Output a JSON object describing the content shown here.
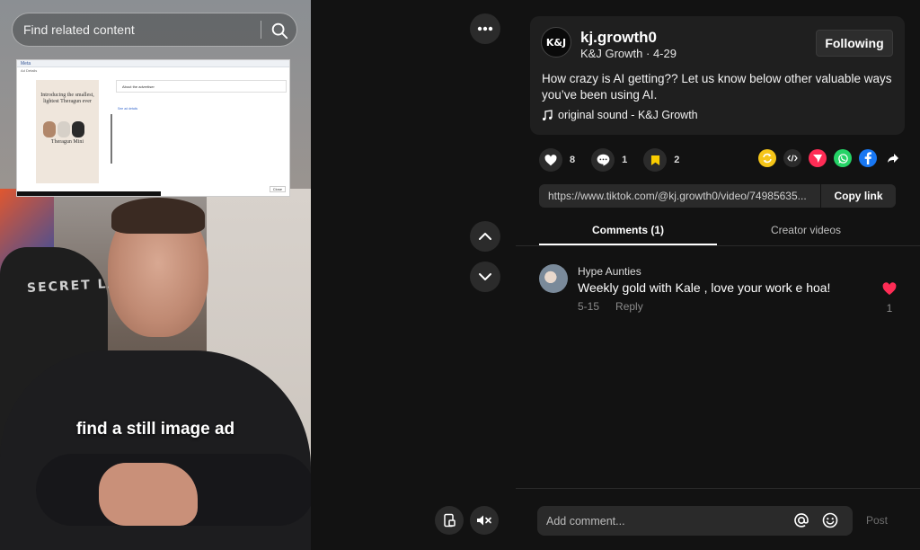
{
  "video": {
    "search_placeholder": "Find related content",
    "caption": "find a still image ad",
    "chair_text": "SECRET LAB",
    "ad_screenshot": {
      "brand": "Meta",
      "poster_headline": "Introducing the smallest, lightest Theragun ever",
      "poster_brand": "Theragun Mini",
      "panel_title": "About the advertiser"
    }
  },
  "controls": {
    "more_label": "More options",
    "up_label": "Previous video",
    "down_label": "Next video"
  },
  "post": {
    "avatar_text": "K&J",
    "username": "kj.growth0",
    "nickname": "K&J Growth",
    "date": "4-29",
    "follow_label": "Following",
    "description": "How crazy is AI getting?? Let us know below other valuable ways you’ve been using AI.",
    "sound": "original sound - K&J Growth",
    "likes": "8",
    "comments": "1",
    "saves": "2",
    "url": "https://www.tiktok.com/@kj.growth0/video/74985635...",
    "copy_label": "Copy link"
  },
  "tabs": {
    "comments": "Comments (1)",
    "creator_videos": "Creator videos"
  },
  "comment_list": [
    {
      "user": "Hype Aunties",
      "text": "Weekly gold with Kale , love your work e hoa!",
      "date": "5-15",
      "reply": "Reply",
      "likes": "1"
    }
  ],
  "composer": {
    "placeholder": "Add comment...",
    "post_label": "Post"
  },
  "colors": {
    "like_red": "#fe2c55",
    "save_yellow": "#facd00",
    "whatsapp": "#25d366",
    "facebook": "#1877f2",
    "repost_yellow": "#f5c518"
  }
}
